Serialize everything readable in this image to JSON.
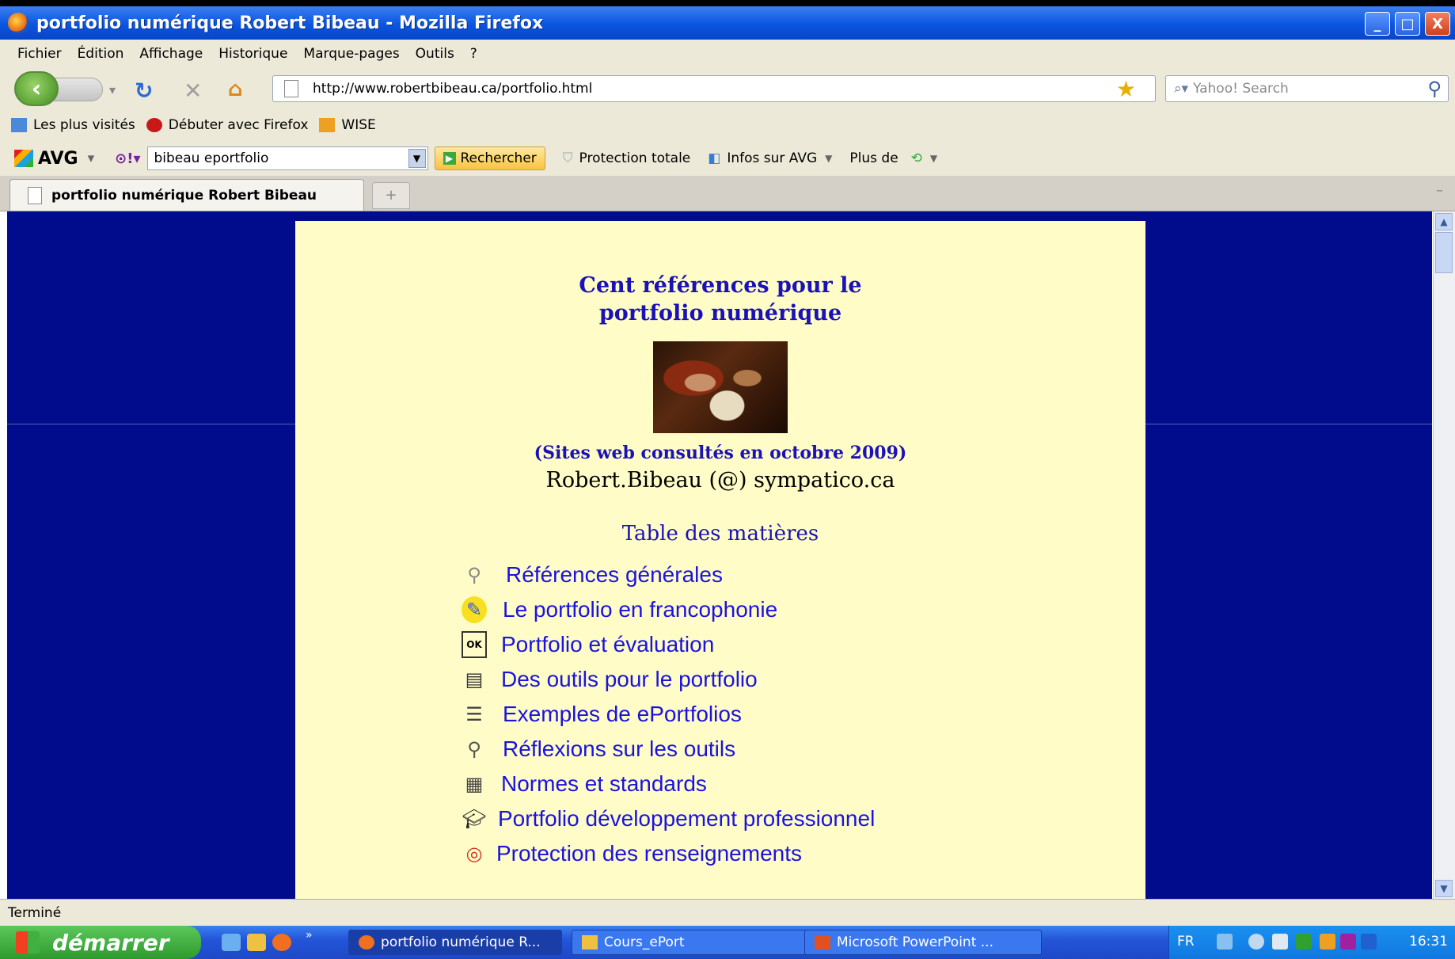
{
  "window": {
    "title": "portfolio numérique Robert Bibeau - Mozilla Firefox",
    "buttons": [
      "_",
      "□",
      "X"
    ]
  },
  "menu": [
    "Fichier",
    "Édition",
    "Affichage",
    "Historique",
    "Marque-pages",
    "Outils",
    "?"
  ],
  "nav": {
    "url": "http://www.robertbibeau.ca/portfolio.html",
    "search_placeholder": "Yahoo! Search"
  },
  "bookmarks": [
    "Les plus visités",
    "Débuter avec Firefox",
    "WISE"
  ],
  "avg": {
    "logo": "AVG",
    "query": "bibeau eportfolio",
    "search_button": "Rechercher",
    "items": [
      "Protection totale",
      "Infos sur AVG",
      "Plus de"
    ]
  },
  "tabs": [
    {
      "label": "portfolio numérique Robert Bibeau"
    }
  ],
  "page": {
    "title_line1": "Cent références pour le",
    "title_line2": "portfolio numérique",
    "sites_note": "(Sites web consultés en octobre 2009)",
    "email": "Robert.Bibeau (@) sympatico.ca",
    "toc_heading": "Table des matières",
    "items": [
      {
        "label": "Références générales",
        "icon": "magnifier-book-icon"
      },
      {
        "label": "Le portfolio en francophonie",
        "icon": "quill-pen-icon"
      },
      {
        "label": "Portfolio et évaluation",
        "icon": "ok-checklist-icon"
      },
      {
        "label": "Des outils pour le portfolio",
        "icon": "toolbox-icon"
      },
      {
        "label": "Exemples de ePortfolios",
        "icon": "file-cabinet-icon"
      },
      {
        "label": "Réflexions sur les outils",
        "icon": "magnifying-glass-icon"
      },
      {
        "label": "Normes et standards",
        "icon": "document-icon"
      },
      {
        "label": "Portfolio développement professionnel",
        "icon": "graduation-cap-icon"
      },
      {
        "label": "Protection des renseignements",
        "icon": "lifebuoy-icon"
      }
    ]
  },
  "status": "Terminé",
  "taskbar": {
    "start": "démarrer",
    "tasks": [
      "portfolio numérique R...",
      "Cours_ePort",
      "Microsoft PowerPoint ..."
    ],
    "lang": "FR",
    "clock": "16:31"
  },
  "colors": {
    "page_background": "#000c8c",
    "panel_background": "#fffcc8",
    "heading": "#1a12b8",
    "link": "#1a12e0"
  }
}
